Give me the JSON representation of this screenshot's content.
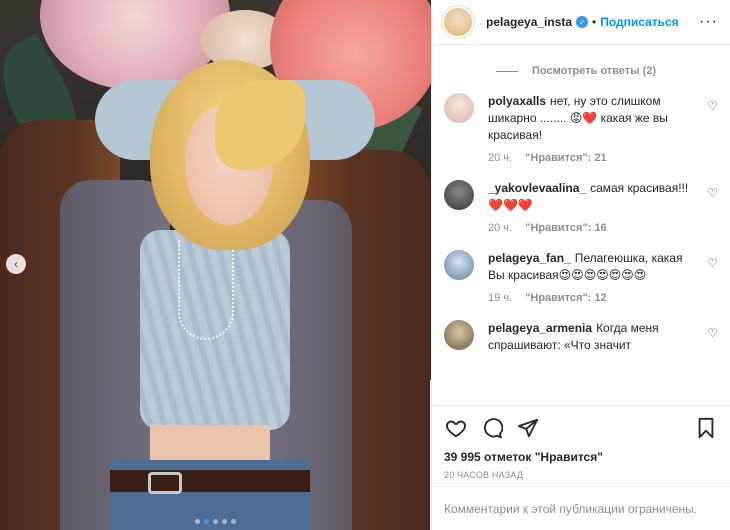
{
  "post": {
    "username": "pelageya_insta",
    "separator": "•",
    "follow_label": "Подписаться",
    "more_icon": "more-horizontal-icon"
  },
  "photo": {
    "carousel_dots": 5,
    "active_dot": 2
  },
  "comments": {
    "view_replies_label": "Посмотреть ответы (2)",
    "items": [
      {
        "username": "polyaxalls",
        "text": "нет, ну это слишком шикарно ........ 😡❤️ какая же вы красивая!",
        "time": "20 ч.",
        "likes": "\"Нравится\": 21",
        "avatar_color": "#e9d6cf"
      },
      {
        "username": "_yakovlevaalina_",
        "text": "самая красивая!!! ❤️❤️❤️",
        "time": "20 ч.",
        "likes": "\"Нравится\": 16",
        "avatar_color": "#4a4a4a"
      },
      {
        "username": "pelageya_fan_",
        "text": "Пелагеюшка, какая Вы красивая😍😍😍😍😍😍😍",
        "time": "19 ч.",
        "likes": "\"Нравится\": 12",
        "avatar_color": "#6a8bb0"
      },
      {
        "username": "pelageya_armenia",
        "text": "Когда меня спрашивают: «Что значит",
        "time": "",
        "likes": "",
        "avatar_color": "#8a7a5e"
      }
    ]
  },
  "actions": {
    "like_icon": "heart-icon",
    "comment_icon": "comment-icon",
    "share_icon": "share-icon",
    "save_icon": "bookmark-icon"
  },
  "likes_count": "39 995 отметок \"Нравится\"",
  "timestamp": "20 часов назад",
  "comments_restricted": "Комментарии к этой публикации ограничены."
}
